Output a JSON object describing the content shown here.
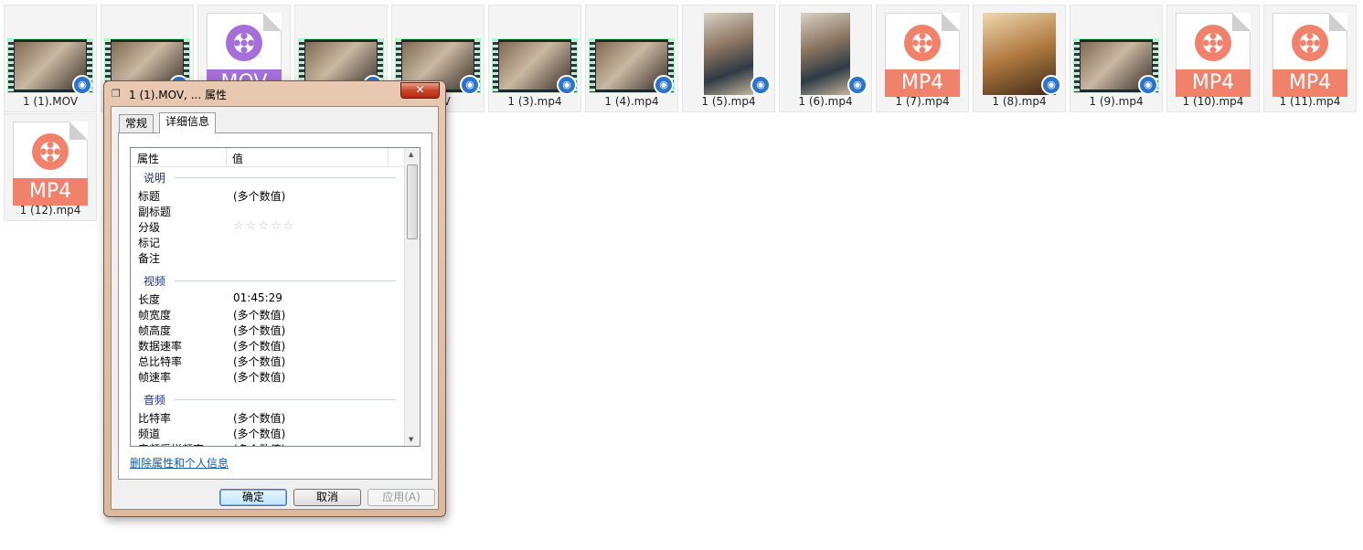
{
  "files": [
    {
      "name": "1 (1).MOV",
      "type": "film"
    },
    {
      "name": "",
      "type": "film"
    },
    {
      "name": "",
      "type": "doc",
      "ext": "MOV"
    },
    {
      "name": "",
      "type": "film"
    },
    {
      "name": "MOV",
      "type": "film"
    },
    {
      "name": "1 (3).mp4",
      "type": "film"
    },
    {
      "name": "1 (4).mp4",
      "type": "film"
    },
    {
      "name": "1 (5).mp4",
      "type": "photo"
    },
    {
      "name": "1 (6).mp4",
      "type": "photo"
    },
    {
      "name": "1 (7).mp4",
      "type": "doc",
      "ext": "MP4"
    },
    {
      "name": "1 (8).mp4",
      "type": "photo-wide"
    },
    {
      "name": "1 (9).mp4",
      "type": "film"
    },
    {
      "name": "1 (10).mp4",
      "type": "doc",
      "ext": "MP4"
    },
    {
      "name": "1 (11).mp4",
      "type": "doc",
      "ext": "MP4"
    },
    {
      "name": "1 (12).mp4",
      "type": "doc",
      "ext": "MP4"
    }
  ],
  "dialog": {
    "title": "1 (1).MOV, ... 属性",
    "close_label": "✕",
    "tabs": [
      "常规",
      "详细信息"
    ],
    "header": {
      "property": "属性",
      "value": "值"
    },
    "groups": [
      {
        "name": "说明",
        "rows": [
          {
            "label": "标题",
            "value": "(多个数值)"
          },
          {
            "label": "副标题",
            "value": ""
          },
          {
            "label": "分级",
            "value": "",
            "stars": 5
          },
          {
            "label": "标记",
            "value": ""
          },
          {
            "label": "备注",
            "value": ""
          }
        ]
      },
      {
        "name": "视频",
        "rows": [
          {
            "label": "长度",
            "value": "01:45:29"
          },
          {
            "label": "帧宽度",
            "value": "(多个数值)"
          },
          {
            "label": "帧高度",
            "value": "(多个数值)"
          },
          {
            "label": "数据速率",
            "value": "(多个数值)"
          },
          {
            "label": "总比特率",
            "value": "(多个数值)"
          },
          {
            "label": "帧速率",
            "value": "(多个数值)"
          }
        ]
      },
      {
        "name": "音频",
        "rows": [
          {
            "label": "比特率",
            "value": "(多个数值)"
          },
          {
            "label": "频道",
            "value": "(多个数值)"
          },
          {
            "label": "音频采样频率",
            "value": "(多个数值)"
          }
        ]
      }
    ],
    "remove_link": "删除属性和个人信息",
    "buttons": {
      "ok": "确定",
      "cancel": "取消",
      "apply": "应用(A)"
    }
  },
  "colors": {
    "mp4": "#f0826c",
    "mov": "#a46fd8",
    "badge": "#2b74c8"
  }
}
